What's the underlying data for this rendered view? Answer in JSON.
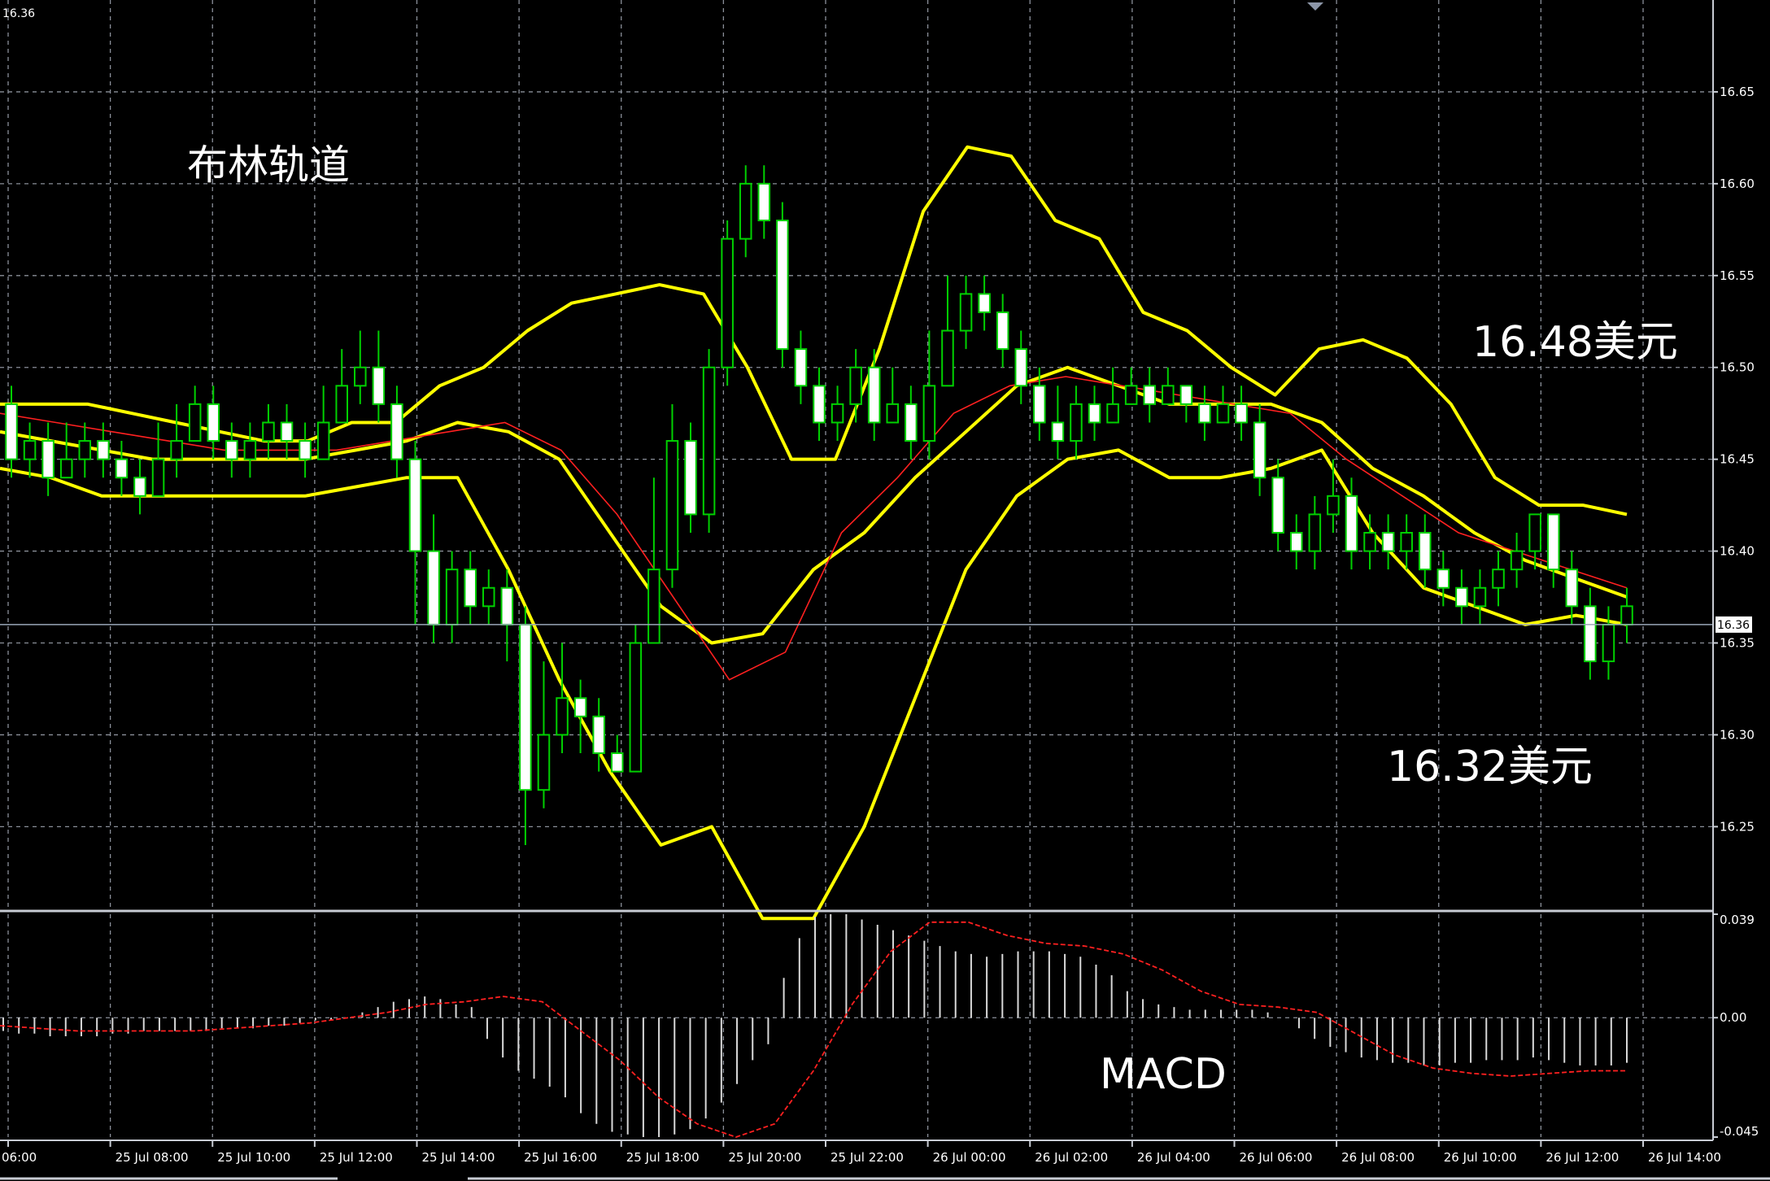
{
  "top_left_price": "16.36",
  "current_price_label": "16.36",
  "annotations": {
    "bollinger": "布林轨道",
    "upper_price": "16.48美元",
    "lower_price": "16.32美元",
    "macd": "MACD"
  },
  "colors": {
    "background": "#000000",
    "grid": "#8a8f99",
    "candle_bull": "#00d000",
    "candle_bear": "#00d000",
    "body_bear_fill": "#ffffff",
    "bollinger": "#ffff00",
    "ma": "#ff2020",
    "macd_hist": "#d8d8d8",
    "macd_signal": "#ff2020",
    "axis_text": "#ffffff",
    "price_line": "#9aa6b8"
  },
  "chart_data": [
    {
      "type": "candlestick",
      "panel": "price",
      "title": "布林轨道",
      "ylim": [
        16.205,
        16.7
      ],
      "yticks": [
        "16.25",
        "16.30",
        "16.35",
        "16.40",
        "16.45",
        "16.50",
        "16.55",
        "16.60",
        "16.65"
      ],
      "xticks": [
        "06:00",
        "25 Jul 08:00",
        "25 Jul 10:00",
        "25 Jul 12:00",
        "25 Jul 14:00",
        "25 Jul 16:00",
        "25 Jul 18:00",
        "25 Jul 20:00",
        "25 Jul 22:00",
        "26 Jul 00:00",
        "26 Jul 02:00",
        "26 Jul 04:00",
        "26 Jul 06:00",
        "26 Jul 08:00",
        "26 Jul 10:00",
        "26 Jul 12:00",
        "26 Jul 14:00"
      ],
      "last_price": 16.36,
      "candles": [
        [
          16.48,
          16.45,
          16.49,
          16.44
        ],
        [
          16.45,
          16.46,
          16.47,
          16.44
        ],
        [
          16.46,
          16.44,
          16.47,
          16.43
        ],
        [
          16.44,
          16.45,
          16.47,
          16.44
        ],
        [
          16.45,
          16.46,
          16.47,
          16.44
        ],
        [
          16.46,
          16.45,
          16.47,
          16.44
        ],
        [
          16.45,
          16.44,
          16.46,
          16.43
        ],
        [
          16.44,
          16.43,
          16.45,
          16.42
        ],
        [
          16.43,
          16.45,
          16.47,
          16.43
        ],
        [
          16.45,
          16.46,
          16.48,
          16.44
        ],
        [
          16.46,
          16.48,
          16.49,
          16.46
        ],
        [
          16.48,
          16.46,
          16.49,
          16.45
        ],
        [
          16.46,
          16.45,
          16.47,
          16.44
        ],
        [
          16.45,
          16.46,
          16.47,
          16.44
        ],
        [
          16.46,
          16.47,
          16.48,
          16.45
        ],
        [
          16.47,
          16.46,
          16.48,
          16.45
        ],
        [
          16.46,
          16.45,
          16.47,
          16.44
        ],
        [
          16.45,
          16.47,
          16.49,
          16.45
        ],
        [
          16.47,
          16.49,
          16.51,
          16.47
        ],
        [
          16.49,
          16.5,
          16.52,
          16.48
        ],
        [
          16.5,
          16.48,
          16.52,
          16.47
        ],
        [
          16.48,
          16.45,
          16.49,
          16.44
        ],
        [
          16.45,
          16.4,
          16.46,
          16.36
        ],
        [
          16.4,
          16.36,
          16.42,
          16.35
        ],
        [
          16.36,
          16.39,
          16.4,
          16.35
        ],
        [
          16.39,
          16.37,
          16.4,
          16.36
        ],
        [
          16.37,
          16.38,
          16.39,
          16.36
        ],
        [
          16.38,
          16.36,
          16.39,
          16.34
        ],
        [
          16.36,
          16.27,
          16.37,
          16.24
        ],
        [
          16.27,
          16.3,
          16.34,
          16.26
        ],
        [
          16.3,
          16.32,
          16.35,
          16.29
        ],
        [
          16.32,
          16.31,
          16.33,
          16.29
        ],
        [
          16.31,
          16.29,
          16.32,
          16.28
        ],
        [
          16.29,
          16.28,
          16.3,
          16.28
        ],
        [
          16.28,
          16.35,
          16.36,
          16.28
        ],
        [
          16.35,
          16.39,
          16.44,
          16.35
        ],
        [
          16.39,
          16.46,
          16.48,
          16.38
        ],
        [
          16.46,
          16.42,
          16.47,
          16.41
        ],
        [
          16.42,
          16.5,
          16.51,
          16.41
        ],
        [
          16.5,
          16.57,
          16.58,
          16.49
        ],
        [
          16.57,
          16.6,
          16.61,
          16.56
        ],
        [
          16.6,
          16.58,
          16.61,
          16.57
        ],
        [
          16.58,
          16.51,
          16.59,
          16.5
        ],
        [
          16.51,
          16.49,
          16.52,
          16.48
        ],
        [
          16.49,
          16.47,
          16.5,
          16.46
        ],
        [
          16.47,
          16.48,
          16.49,
          16.46
        ],
        [
          16.48,
          16.5,
          16.51,
          16.47
        ],
        [
          16.5,
          16.47,
          16.51,
          16.46
        ],
        [
          16.47,
          16.48,
          16.5,
          16.47
        ],
        [
          16.48,
          16.46,
          16.49,
          16.45
        ],
        [
          16.46,
          16.49,
          16.52,
          16.45
        ],
        [
          16.49,
          16.52,
          16.55,
          16.49
        ],
        [
          16.52,
          16.54,
          16.55,
          16.51
        ],
        [
          16.54,
          16.53,
          16.55,
          16.52
        ],
        [
          16.53,
          16.51,
          16.54,
          16.5
        ],
        [
          16.51,
          16.49,
          16.52,
          16.48
        ],
        [
          16.49,
          16.47,
          16.5,
          16.46
        ],
        [
          16.47,
          16.46,
          16.49,
          16.45
        ],
        [
          16.46,
          16.48,
          16.49,
          16.45
        ],
        [
          16.48,
          16.47,
          16.49,
          16.46
        ],
        [
          16.47,
          16.48,
          16.5,
          16.47
        ],
        [
          16.48,
          16.49,
          16.5,
          16.48
        ],
        [
          16.49,
          16.48,
          16.5,
          16.47
        ],
        [
          16.48,
          16.49,
          16.5,
          16.48
        ],
        [
          16.49,
          16.48,
          16.49,
          16.47
        ],
        [
          16.48,
          16.47,
          16.49,
          16.46
        ],
        [
          16.47,
          16.48,
          16.49,
          16.47
        ],
        [
          16.48,
          16.47,
          16.49,
          16.46
        ],
        [
          16.47,
          16.44,
          16.48,
          16.43
        ],
        [
          16.44,
          16.41,
          16.45,
          16.4
        ],
        [
          16.41,
          16.4,
          16.42,
          16.39
        ],
        [
          16.4,
          16.42,
          16.43,
          16.39
        ],
        [
          16.42,
          16.43,
          16.45,
          16.41
        ],
        [
          16.43,
          16.4,
          16.44,
          16.39
        ],
        [
          16.4,
          16.41,
          16.42,
          16.39
        ],
        [
          16.41,
          16.4,
          16.42,
          16.39
        ],
        [
          16.4,
          16.41,
          16.42,
          16.39
        ],
        [
          16.41,
          16.39,
          16.42,
          16.38
        ],
        [
          16.39,
          16.38,
          16.4,
          16.37
        ],
        [
          16.38,
          16.37,
          16.39,
          16.36
        ],
        [
          16.37,
          16.38,
          16.39,
          16.36
        ],
        [
          16.38,
          16.39,
          16.4,
          16.37
        ],
        [
          16.39,
          16.4,
          16.41,
          16.38
        ],
        [
          16.4,
          16.42,
          16.42,
          16.39
        ],
        [
          16.42,
          16.39,
          16.42,
          16.38
        ],
        [
          16.39,
          16.37,
          16.4,
          16.36
        ],
        [
          16.37,
          16.34,
          16.38,
          16.33
        ],
        [
          16.34,
          16.36,
          16.37,
          16.33
        ],
        [
          16.36,
          16.37,
          16.38,
          16.35
        ]
      ],
      "bollinger_upper": [
        16.48,
        16.48,
        16.48,
        16.475,
        16.47,
        16.465,
        16.46,
        16.46,
        16.47,
        16.47,
        16.49,
        16.5,
        16.52,
        16.535,
        16.54,
        16.545,
        16.54,
        16.5,
        16.45,
        16.45,
        16.51,
        16.585,
        16.62,
        16.615,
        16.58,
        16.57,
        16.53,
        16.52,
        16.5,
        16.485,
        16.51,
        16.515,
        16.505,
        16.48,
        16.44,
        16.425,
        16.425,
        16.42
      ],
      "bollinger_mid": [
        16.465,
        16.46,
        16.455,
        16.45,
        16.45,
        16.45,
        16.45,
        16.455,
        16.46,
        16.47,
        16.465,
        16.45,
        16.41,
        16.37,
        16.35,
        16.355,
        16.39,
        16.41,
        16.44,
        16.465,
        16.49,
        16.5,
        16.49,
        16.48,
        16.48,
        16.48,
        16.47,
        16.445,
        16.43,
        16.41,
        16.395,
        16.385,
        16.375
      ],
      "bollinger_lower": [
        16.445,
        16.44,
        16.43,
        16.43,
        16.43,
        16.43,
        16.43,
        16.435,
        16.44,
        16.44,
        16.39,
        16.33,
        16.28,
        16.24,
        16.25,
        16.2,
        16.2,
        16.25,
        16.32,
        16.39,
        16.43,
        16.45,
        16.455,
        16.44,
        16.44,
        16.445,
        16.455,
        16.41,
        16.38,
        16.37,
        16.36,
        16.365,
        16.36
      ],
      "ma": [
        16.475,
        16.47,
        16.465,
        16.46,
        16.455,
        16.455,
        16.455,
        16.46,
        16.465,
        16.47,
        16.455,
        16.42,
        16.375,
        16.33,
        16.345,
        16.41,
        16.44,
        16.475,
        16.49,
        16.495,
        16.49,
        16.485,
        16.48,
        16.475,
        16.45,
        16.43,
        16.41,
        16.4,
        16.39,
        16.38
      ]
    },
    {
      "type": "macd",
      "panel": "indicator",
      "title": "MACD",
      "ylim": [
        -0.045,
        0.039
      ],
      "yticks": [
        "0.039",
        "0.00",
        "-0.045"
      ],
      "histogram": [
        -0.005,
        -0.006,
        -0.006,
        -0.007,
        -0.007,
        -0.007,
        -0.007,
        -0.006,
        -0.006,
        -0.005,
        -0.005,
        -0.005,
        -0.005,
        -0.005,
        -0.004,
        -0.004,
        -0.004,
        -0.003,
        -0.003,
        -0.002,
        -0.001,
        -0.001,
        0.0,
        0.002,
        0.004,
        0.006,
        0.007,
        0.008,
        0.007,
        0.005,
        0.004,
        -0.008,
        -0.015,
        -0.02,
        -0.023,
        -0.026,
        -0.03,
        -0.036,
        -0.04,
        -0.043,
        -0.044,
        -0.045,
        -0.045,
        -0.044,
        -0.042,
        -0.038,
        -0.032,
        -0.025,
        -0.016,
        -0.01,
        0.015,
        0.03,
        0.038,
        0.039,
        0.039,
        0.037,
        0.035,
        0.033,
        0.031,
        0.029,
        0.027,
        0.025,
        0.024,
        0.023,
        0.024,
        0.025,
        0.025,
        0.025,
        0.024,
        0.023,
        0.02,
        0.016,
        0.01,
        0.007,
        0.005,
        0.004,
        0.003,
        0.003,
        0.003,
        0.003,
        0.003,
        0.002,
        0.0,
        -0.004,
        -0.008,
        -0.011,
        -0.013,
        -0.015,
        -0.016,
        -0.017,
        -0.017,
        -0.018,
        -0.018,
        -0.017,
        -0.017,
        -0.016,
        -0.016,
        -0.016,
        -0.015,
        -0.016,
        -0.017,
        -0.018,
        -0.018,
        -0.018,
        -0.017
      ],
      "signal": [
        -0.003,
        -0.004,
        -0.005,
        -0.005,
        -0.005,
        -0.005,
        -0.004,
        -0.003,
        -0.002,
        0.0,
        0.002,
        0.005,
        0.006,
        0.008,
        0.006,
        -0.005,
        -0.016,
        -0.03,
        -0.04,
        -0.045,
        -0.04,
        -0.02,
        0.005,
        0.025,
        0.036,
        0.036,
        0.031,
        0.028,
        0.027,
        0.024,
        0.018,
        0.01,
        0.005,
        0.004,
        0.002,
        -0.006,
        -0.014,
        -0.019,
        -0.021,
        -0.022,
        -0.021,
        -0.02,
        -0.02
      ]
    }
  ]
}
